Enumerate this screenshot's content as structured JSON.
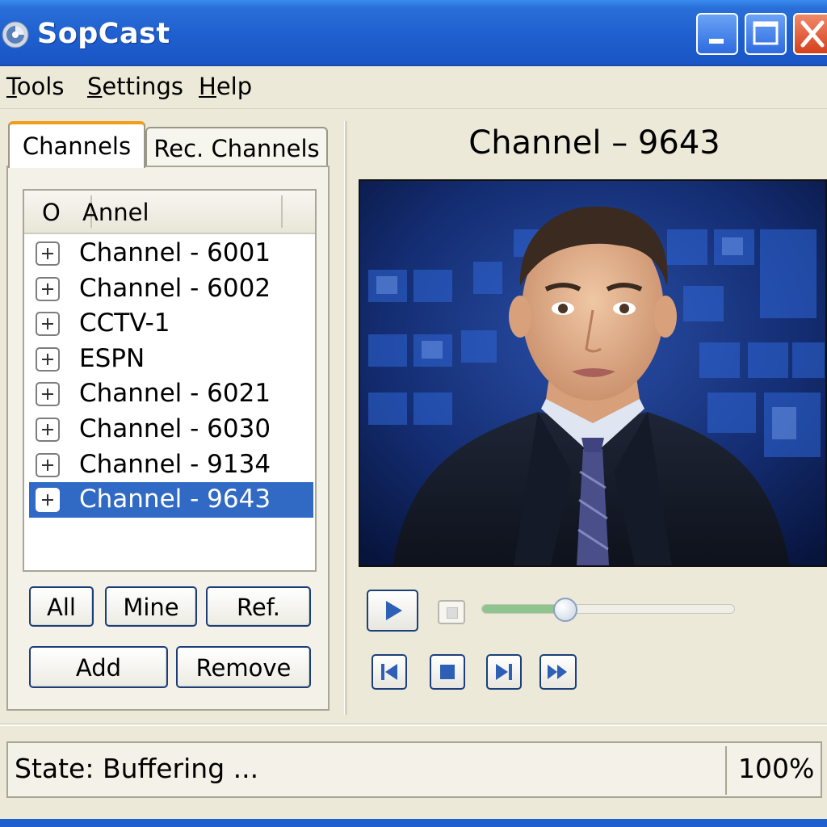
{
  "window": {
    "title": "SopCast",
    "minimize_icon": "minimize-icon",
    "maximize_icon": "maximize-icon",
    "close_icon": "close-icon"
  },
  "menu": {
    "items": [
      {
        "ul": "T",
        "rest": "ools"
      },
      {
        "ul": "S",
        "rest": "ettings"
      },
      {
        "ul": "H",
        "rest": "elp"
      }
    ]
  },
  "tabs": {
    "channels": "Channels",
    "rec_channels": "Rec. Channels",
    "active": "Channels"
  },
  "channel_list": {
    "headers": {
      "col1": "O",
      "col2": "Annel"
    },
    "items": [
      {
        "label": "Channel - 6001",
        "selected": false
      },
      {
        "label": "Channel - 6002",
        "selected": false
      },
      {
        "label": "CCTV-1",
        "selected": false
      },
      {
        "label": "ESPN",
        "selected": false
      },
      {
        "label": "Channel - 6021",
        "selected": false
      },
      {
        "label": "Channel - 6030",
        "selected": false
      },
      {
        "label": "Channel - 9134",
        "selected": false
      },
      {
        "label": "Channel - 9643",
        "selected": true
      }
    ]
  },
  "filter_buttons": {
    "all": "All",
    "mine": "Mine",
    "ref": "Ref."
  },
  "action_buttons": {
    "add": "Add",
    "remove": "Remove"
  },
  "player": {
    "channel_title": "Channel – 9643",
    "volume_fraction": 0.33,
    "colors": {
      "accent": "#316ac5",
      "titlebar": "#1f5fcf",
      "volume_fill": "#8fc48f"
    }
  },
  "status": {
    "text": "State:  Buffering ...",
    "percent": "100%"
  }
}
